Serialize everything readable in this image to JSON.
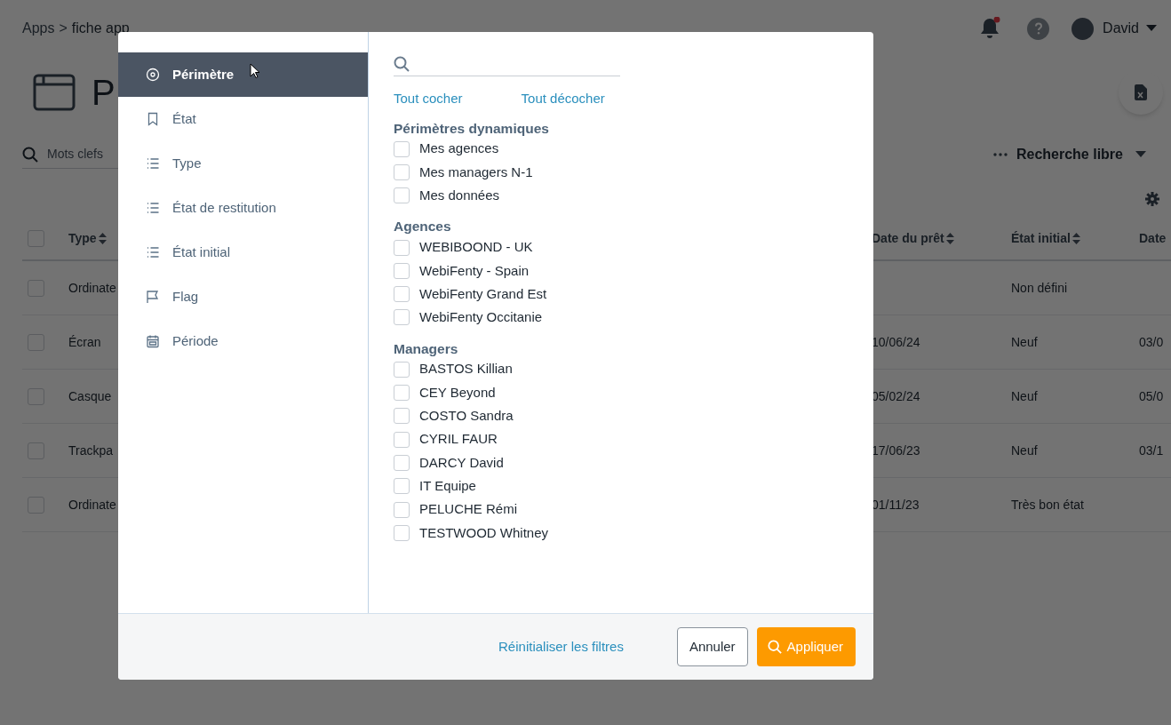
{
  "breadcrumb": {
    "root": "Apps",
    "separator": ">",
    "current": "fiche app"
  },
  "page_title": "P",
  "header": {
    "user": "David"
  },
  "toolbar": {
    "search_placeholder": "Mots clefs",
    "search_mode": "Recherche libre"
  },
  "table": {
    "select_all_checked": false,
    "columns": [
      "Type",
      "Date du prêt",
      "État initial",
      "Date"
    ],
    "rows": [
      {
        "checked": false,
        "cells": [
          "Ordinate",
          "",
          "Non défini",
          ""
        ]
      },
      {
        "checked": false,
        "cells": [
          "Écran",
          "10/06/24",
          "Neuf",
          "03/0"
        ]
      },
      {
        "checked": false,
        "cells": [
          "Casque",
          "05/02/24",
          "Neuf",
          "05/0"
        ]
      },
      {
        "checked": false,
        "cells": [
          "Trackpa",
          "17/06/23",
          "Neuf",
          "03/1"
        ]
      },
      {
        "checked": false,
        "cells": [
          "Ordinate",
          "01/11/23",
          "Très bon état",
          ""
        ]
      }
    ]
  },
  "filter_dialog": {
    "sidebar": [
      {
        "label": "Périmètre",
        "kind": "target",
        "selected": true
      },
      {
        "label": "État",
        "kind": "bookmark",
        "selected": false
      },
      {
        "label": "Type",
        "kind": "list",
        "selected": false
      },
      {
        "label": "État de restitution",
        "kind": "list",
        "selected": false
      },
      {
        "label": "État initial",
        "kind": "list",
        "selected": false
      },
      {
        "label": "Flag",
        "kind": "flag",
        "selected": false
      },
      {
        "label": "Période",
        "kind": "calendar",
        "selected": false
      }
    ],
    "check_all": "Tout cocher",
    "uncheck_all": "Tout décocher",
    "groups": [
      {
        "title": "Périmètres dynamiques",
        "options": [
          {
            "label": "Mes agences",
            "checked": false
          },
          {
            "label": "Mes managers N-1",
            "checked": false
          },
          {
            "label": "Mes données",
            "checked": false
          }
        ]
      },
      {
        "title": "Agences",
        "options": [
          {
            "label": "WEBIBOOND - UK",
            "checked": false
          },
          {
            "label": "WebiFenty - Spain",
            "checked": false
          },
          {
            "label": "WebiFenty Grand Est",
            "checked": false
          },
          {
            "label": "WebiFenty Occitanie",
            "checked": false
          }
        ]
      },
      {
        "title": "Managers",
        "options": [
          {
            "label": "BASTOS Killian",
            "checked": false
          },
          {
            "label": "CEY Beyond",
            "checked": false
          },
          {
            "label": "COSTO Sandra",
            "checked": false
          },
          {
            "label": "CYRIL FAUR",
            "checked": false
          },
          {
            "label": "DARCY David",
            "checked": false
          },
          {
            "label": "IT Equipe",
            "checked": false
          },
          {
            "label": "PELUCHE Rémi",
            "checked": false
          },
          {
            "label": "TESTWOOD Whitney",
            "checked": false
          }
        ]
      }
    ],
    "reset": "Réinitialiser les filtres",
    "cancel": "Annuler",
    "apply": "Appliquer"
  }
}
